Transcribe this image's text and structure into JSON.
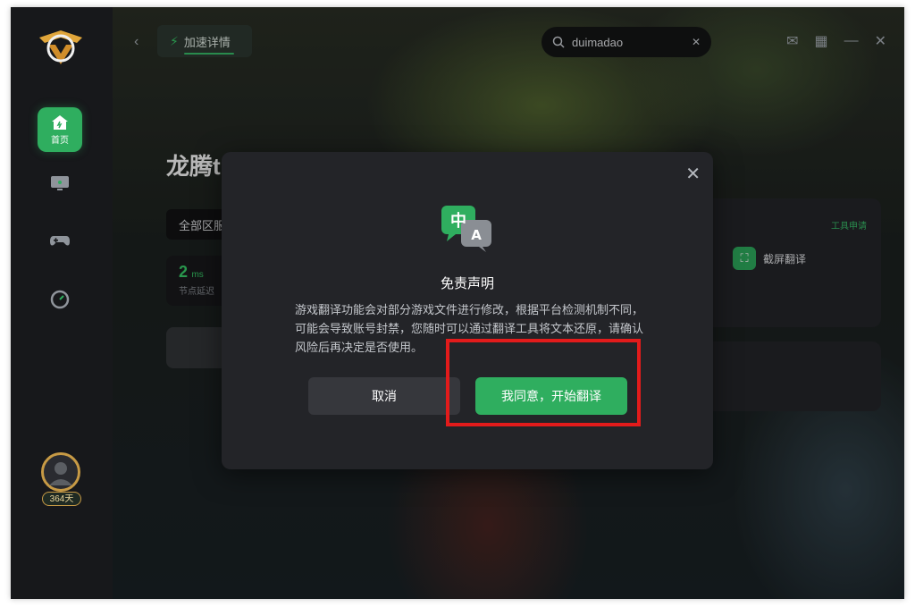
{
  "nav": {
    "home_label": "首页",
    "user_days": "364天"
  },
  "top": {
    "accel_tab_label": "加速详情",
    "search_value": "duimadao"
  },
  "game": {
    "title_partial": "龙腾t",
    "region_partial": "全部区服",
    "ping_value": "2",
    "ping_unit": "ms",
    "ping_label": "节点延迟"
  },
  "tools": {
    "apply_label": "工具申请",
    "screen_translate_label": "截屏翻译"
  },
  "modal": {
    "icon_char_zh": "中",
    "icon_char_a": "A",
    "title": "免责声明",
    "description": "游戏翻译功能会对部分游戏文件进行修改，根据平台检测机制不同，可能会导致账号封禁，您随时可以通过翻译工具将文本还原，请确认风险后再决定是否使用。",
    "cancel_label": "取消",
    "agree_label": "我同意，开始翻译"
  },
  "colors": {
    "accent": "#2fae5f",
    "highlight_box": "#e21b1b"
  }
}
